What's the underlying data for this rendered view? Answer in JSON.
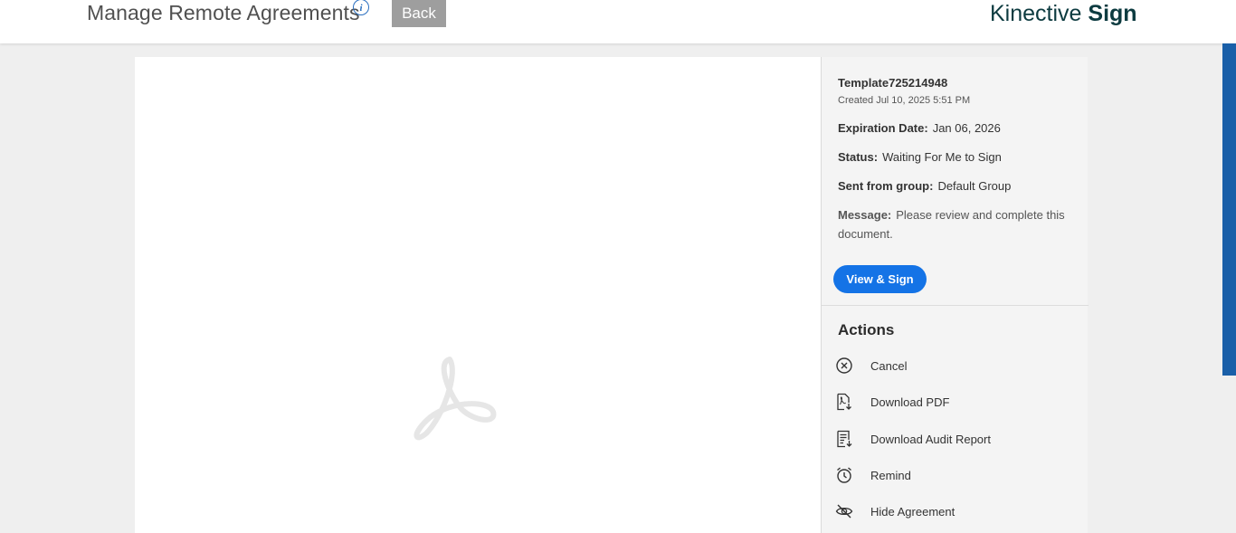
{
  "header": {
    "title": "Manage Remote Agreements",
    "back_label": "Back",
    "brand_light": "Kinective",
    "brand_bold": "Sign"
  },
  "agreement": {
    "name": "Template725214948",
    "created": "Created Jul 10, 2025 5:51 PM",
    "expiration_label": "Expiration Date:",
    "expiration_value": "Jan 06, 2026",
    "status_label": "Status:",
    "status_value": "Waiting For Me to Sign",
    "group_label": "Sent from group:",
    "group_value": "Default Group",
    "message_label": "Message:",
    "message_value": "Please review and complete this document.",
    "primary_action": "View & Sign"
  },
  "actions": {
    "title": "Actions",
    "items": [
      {
        "label": "Cancel",
        "icon": "cancel-circle-icon"
      },
      {
        "label": "Download PDF",
        "icon": "download-pdf-icon"
      },
      {
        "label": "Download Audit Report",
        "icon": "audit-report-icon"
      },
      {
        "label": "Remind",
        "icon": "alarm-clock-icon"
      },
      {
        "label": "Hide Agreement",
        "icon": "eye-slash-icon"
      }
    ]
  },
  "colors": {
    "primary": "#1473e6",
    "brand": "#0d3b40",
    "back_button": "#9e9e9e",
    "scroll_accent": "#1a5fa8"
  }
}
